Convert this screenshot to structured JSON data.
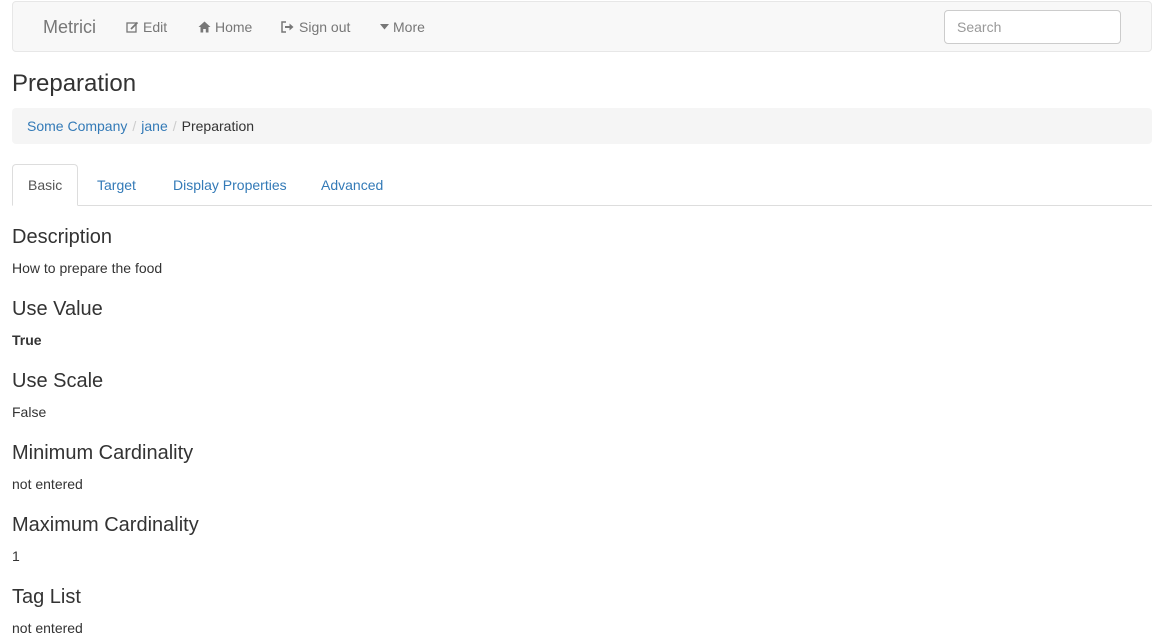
{
  "navbar": {
    "brand": "Metrici",
    "links": [
      {
        "label": "Edit",
        "icon": "edit-icon"
      },
      {
        "label": "Home",
        "icon": "home-icon"
      },
      {
        "label": "Sign out",
        "icon": "sign-out-icon"
      },
      {
        "label": "More",
        "icon": "caret-down-icon"
      }
    ],
    "search_placeholder": "Search"
  },
  "page": {
    "title": "Preparation"
  },
  "breadcrumb": {
    "items": [
      "Some Company",
      "jane"
    ],
    "active": "Preparation"
  },
  "tabs": [
    {
      "label": "Basic",
      "active": true
    },
    {
      "label": "Target",
      "active": false
    },
    {
      "label": "Display Properties",
      "active": false
    },
    {
      "label": "Advanced",
      "active": false
    }
  ],
  "fields": [
    {
      "heading": "Description",
      "value": "How to prepare the food"
    },
    {
      "heading": "Use Value",
      "value": "True"
    },
    {
      "heading": "Use Scale",
      "value": "False"
    },
    {
      "heading": "Minimum Cardinality",
      "value": "not entered"
    },
    {
      "heading": "Maximum Cardinality",
      "value": "1"
    },
    {
      "heading": "Tag List",
      "value": "not entered"
    }
  ],
  "colors": {
    "link": "#337ab7",
    "navbar_bg": "#f8f8f8",
    "breadcrumb_bg": "#f5f5f5"
  }
}
